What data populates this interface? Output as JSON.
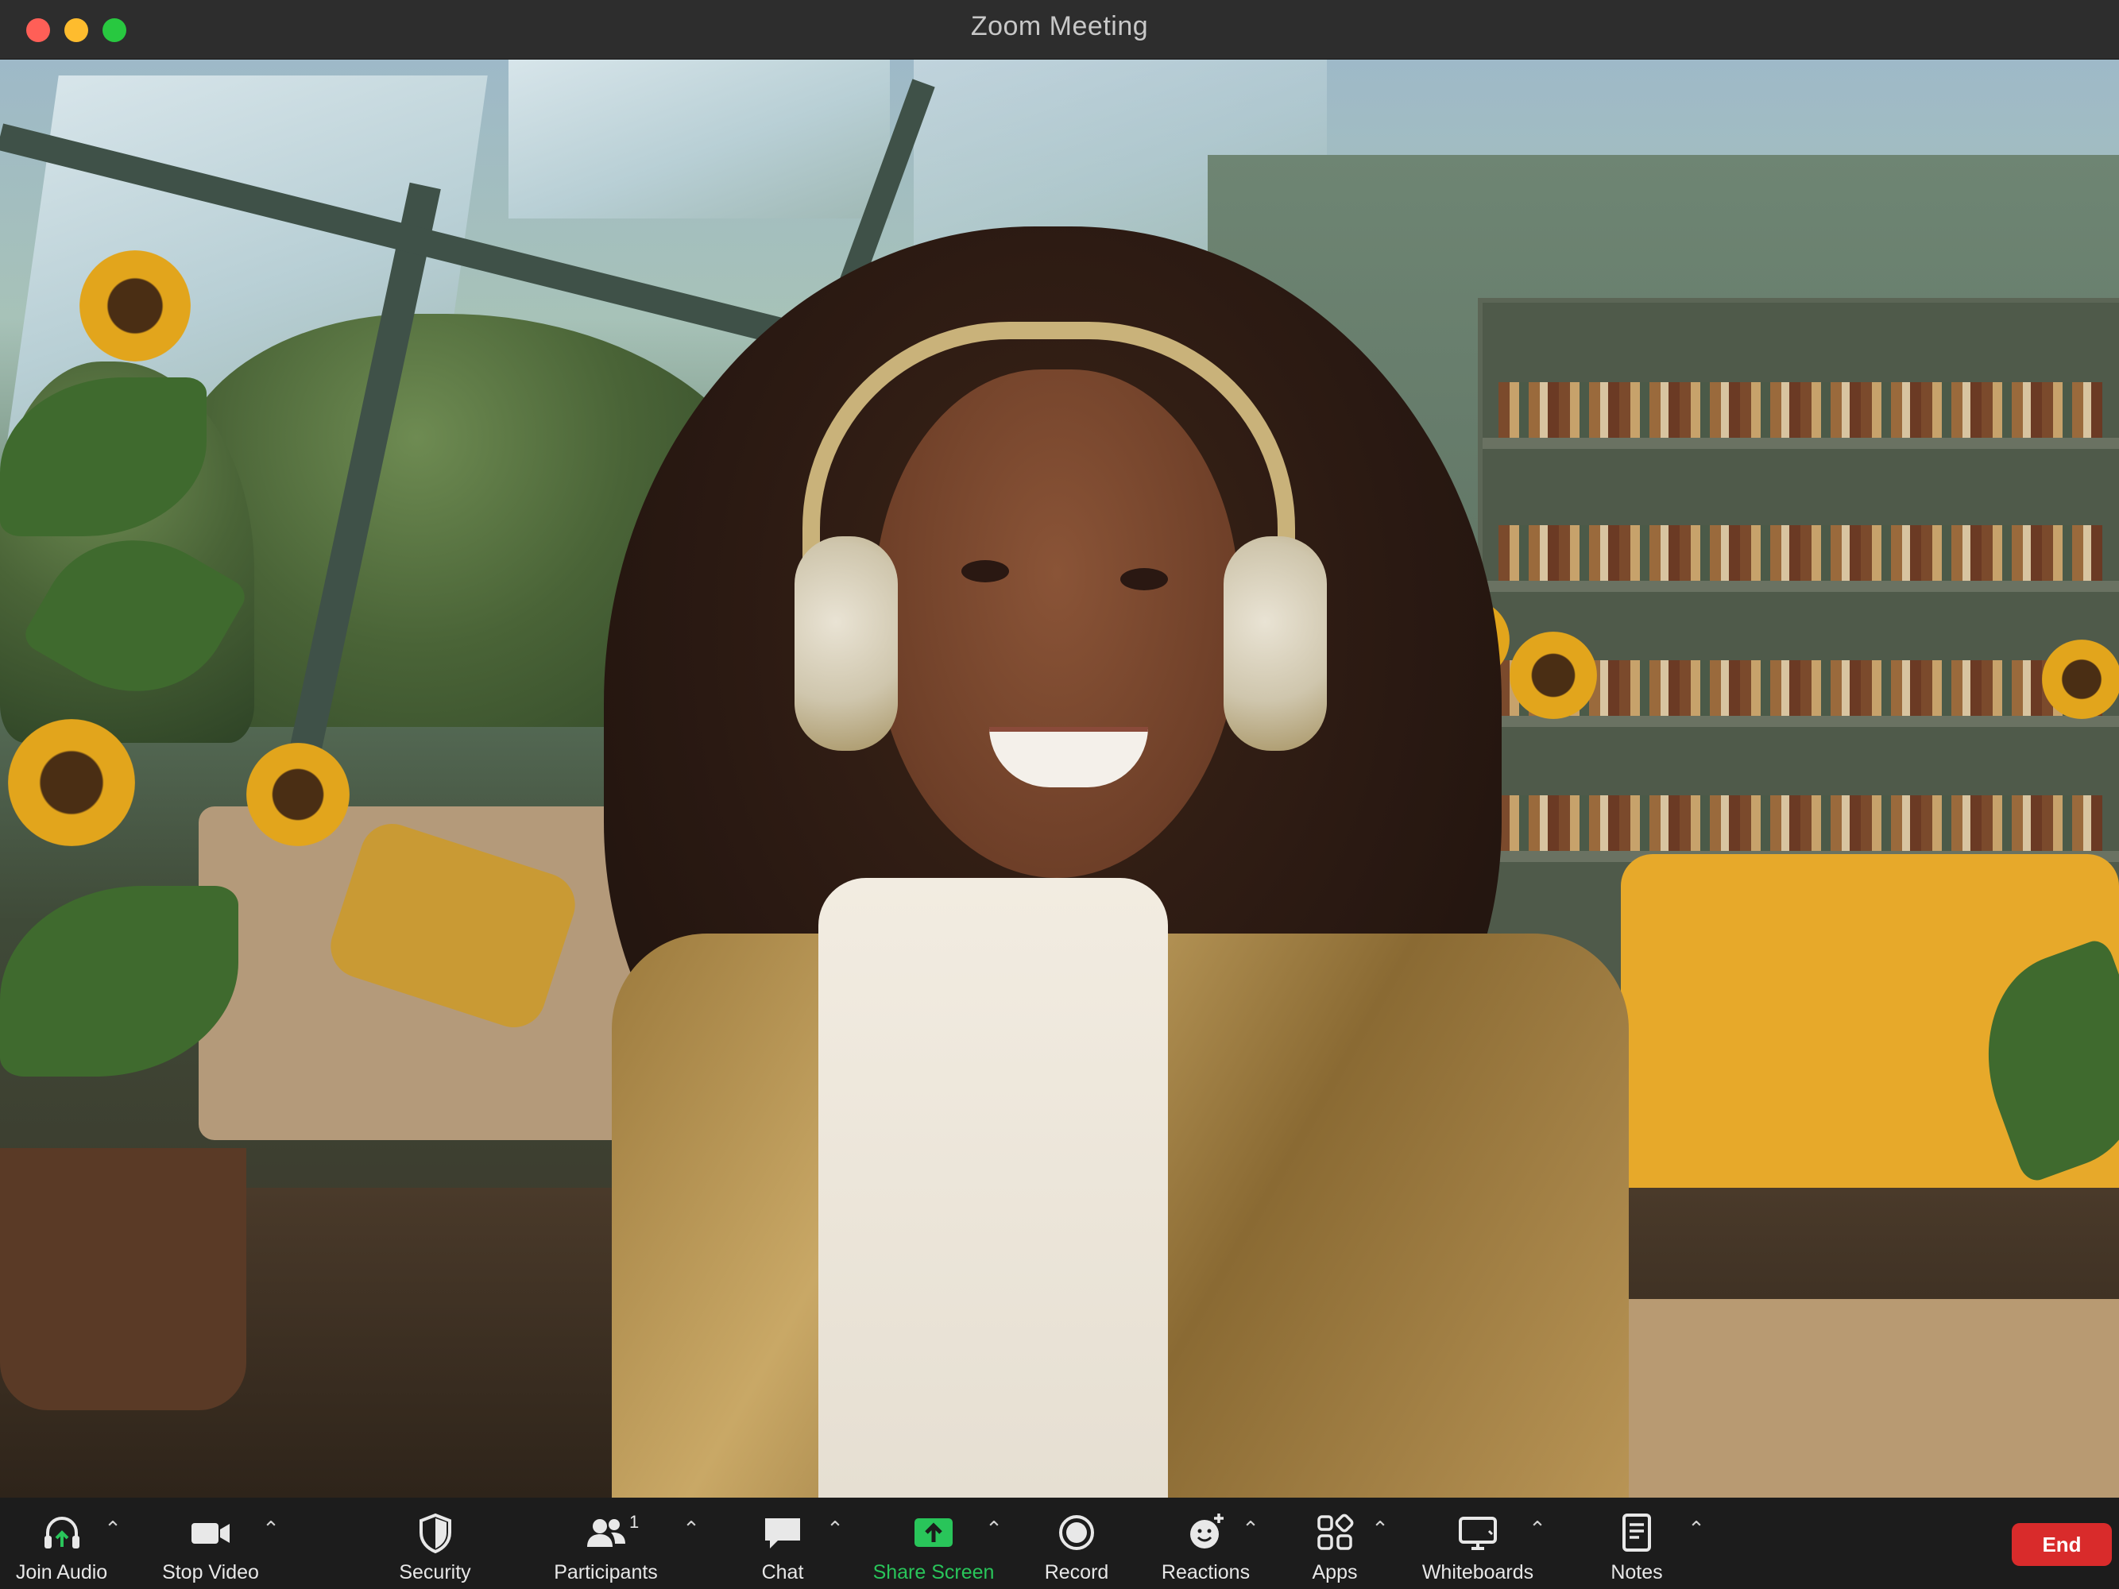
{
  "window": {
    "title": "Zoom Meeting"
  },
  "colors": {
    "accent_green": "#29c55a",
    "end_red": "#d92b2b",
    "toolbar_bg": "#1c1c1c",
    "titlebar_bg": "#2d2d2d"
  },
  "toolbar": {
    "join_audio": {
      "label": "Join Audio",
      "icon": "headphones-upload-icon"
    },
    "stop_video": {
      "label": "Stop Video",
      "icon": "video-camera-icon"
    },
    "security": {
      "label": "Security",
      "icon": "shield-icon"
    },
    "participants": {
      "label": "Participants",
      "icon": "people-icon",
      "count": "1"
    },
    "chat": {
      "label": "Chat",
      "icon": "chat-bubble-icon"
    },
    "share_screen": {
      "label": "Share Screen",
      "icon": "share-screen-icon"
    },
    "record": {
      "label": "Record",
      "icon": "record-icon"
    },
    "reactions": {
      "label": "Reactions",
      "icon": "smiley-plus-icon"
    },
    "apps": {
      "label": "Apps",
      "icon": "apps-icon"
    },
    "whiteboards": {
      "label": "Whiteboards",
      "icon": "whiteboard-icon"
    },
    "notes": {
      "label": "Notes",
      "icon": "notes-icon"
    },
    "end": {
      "label": "End"
    },
    "caret_glyph": "⌃"
  }
}
